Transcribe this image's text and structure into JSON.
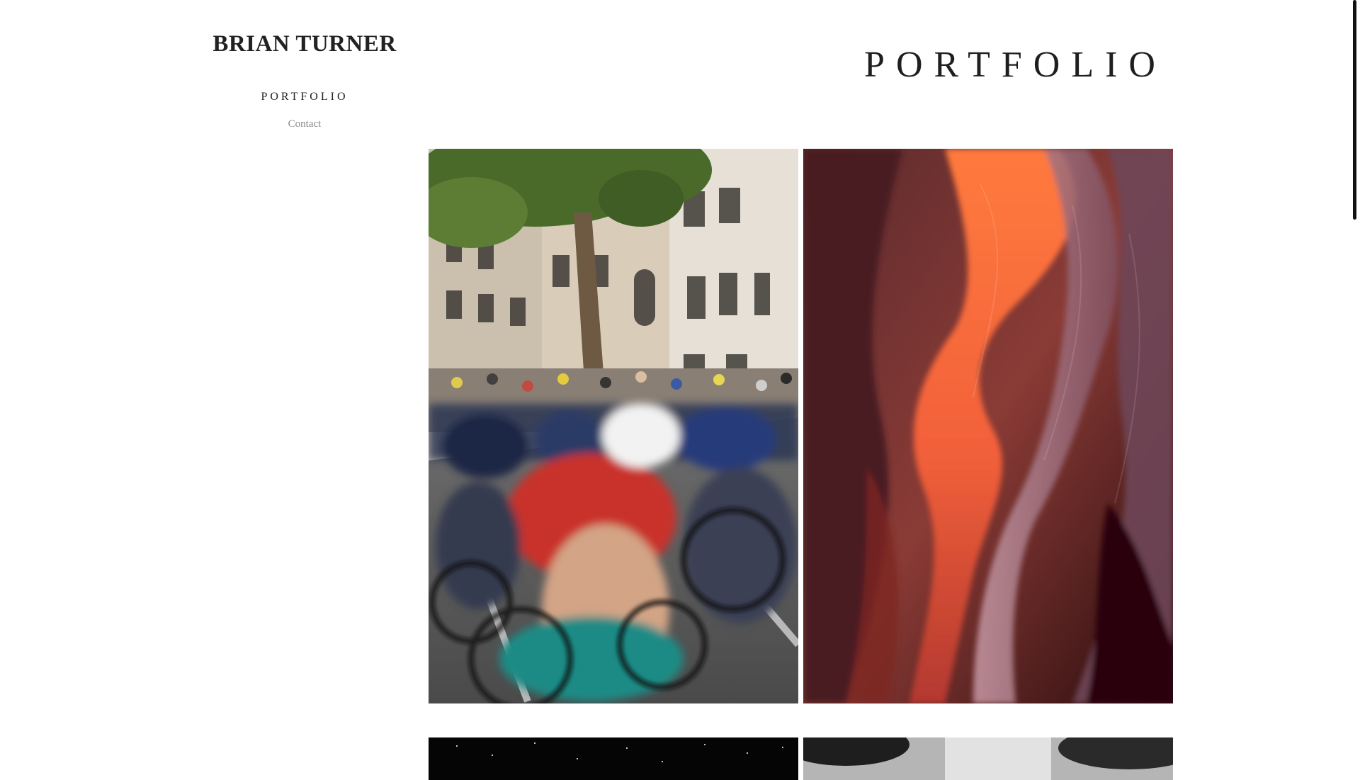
{
  "sidebar": {
    "site_title": "BRIAN TURNER",
    "nav": [
      {
        "label": "PORTFOLIO",
        "active": true
      },
      {
        "label": "Contact",
        "active": false
      }
    ]
  },
  "main": {
    "page_title": "PORTFOLIO",
    "gallery": [
      {
        "subject": "cycling-race-photo"
      },
      {
        "subject": "slot-canyon-photo"
      },
      {
        "subject": "starry-night-photo"
      },
      {
        "subject": "black-and-white-street-photo"
      }
    ]
  },
  "colors": {
    "text_primary": "#222222",
    "text_muted": "#8a8a8a",
    "background": "#ffffff"
  }
}
